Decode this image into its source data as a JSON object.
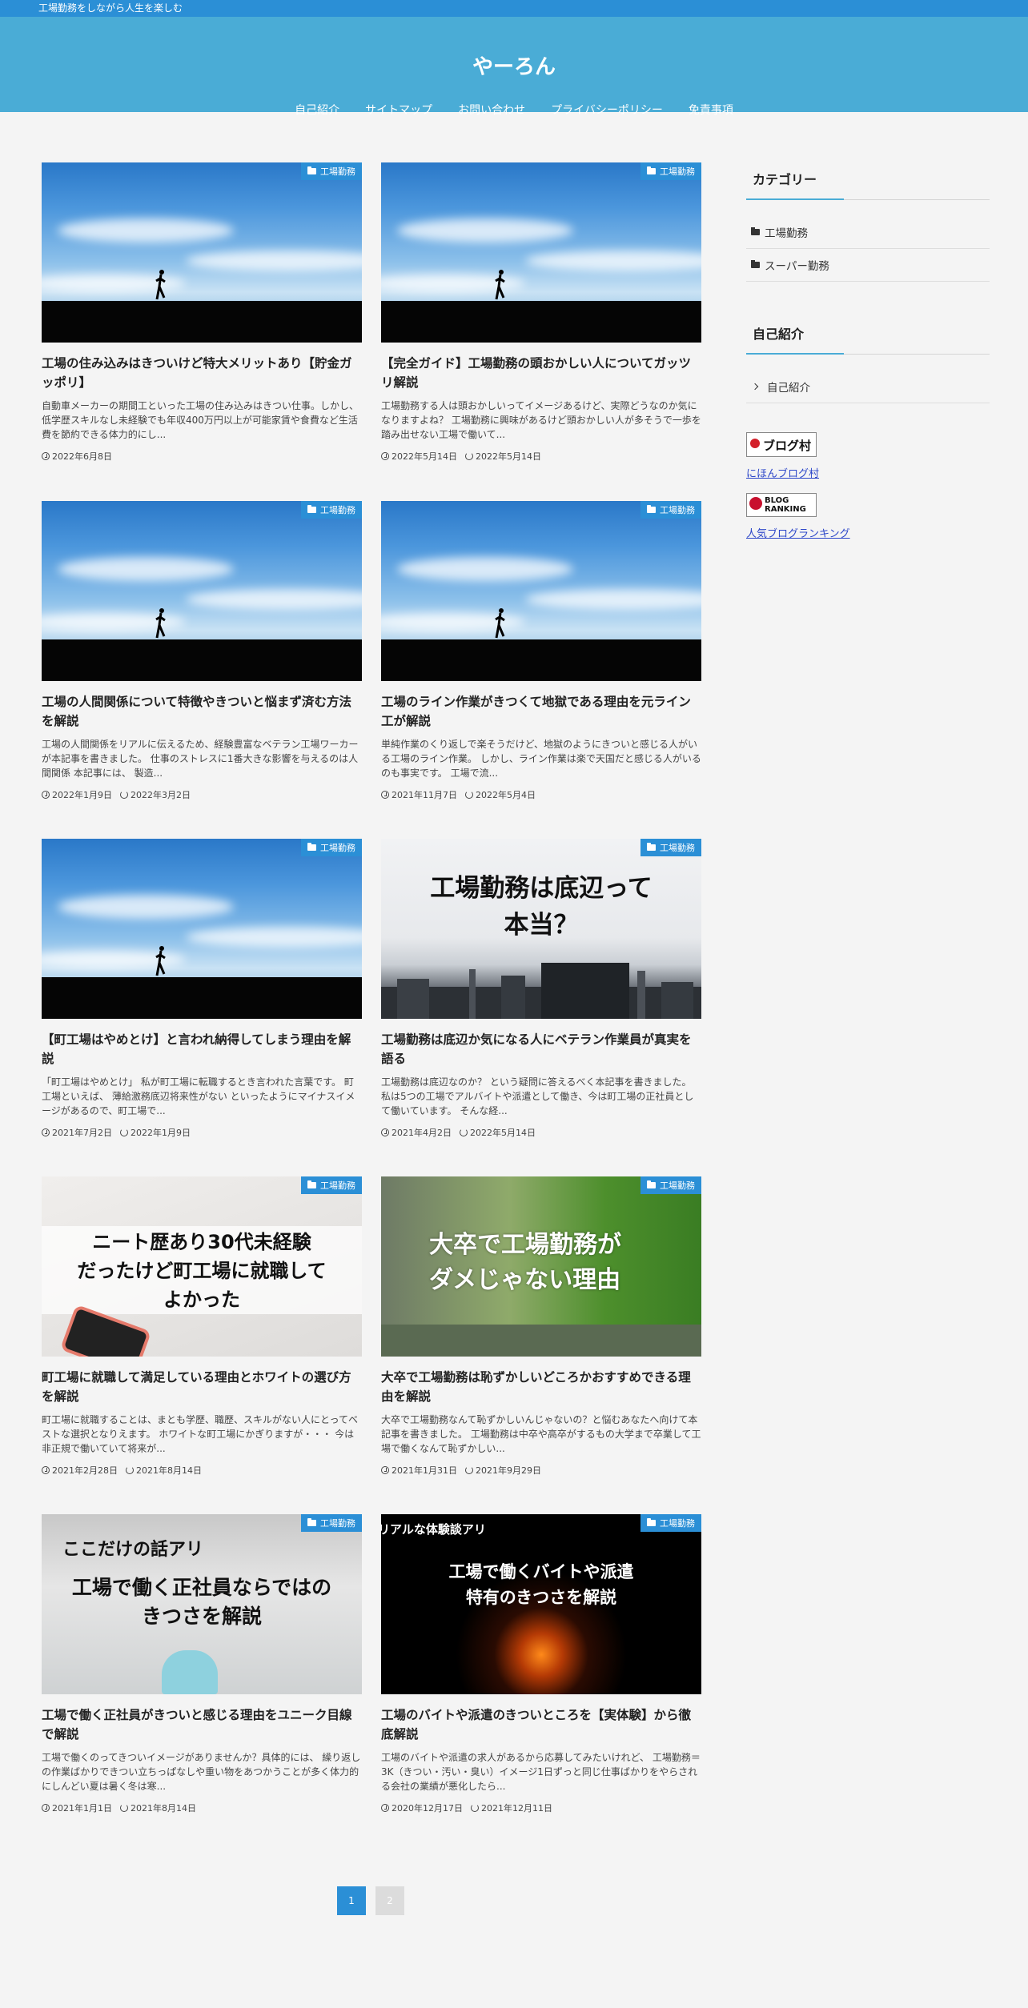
{
  "topbar": {
    "tagline": "工場勤務をしながら人生を楽しむ"
  },
  "site": {
    "title": "やーろん"
  },
  "nav": [
    "自己紹介",
    "サイトマップ",
    "お問い合わせ",
    "プライバシーポリシー",
    "免責事項"
  ],
  "category_label": "工場勤務",
  "posts": [
    {
      "title_l1": "工場の住み込みはきついけど特大メリットあり【貯金ガ",
      "title_l2": "ッポリ】",
      "excerpt": "自動車メーカーの期間工といった工場の住み込みはきつい仕事。しかし、 低学歴スキルなし未経験でも年収400万円以上が可能家賃や食費など生活費を節約できる体力的にし...",
      "date": "2022年6月8日",
      "updated": ""
    },
    {
      "title_l1": "【完全ガイド】工場勤務の頭おかしい人についてガッツ",
      "title_l2": "リ解説",
      "excerpt": "工場勤務する人は頭おかしいってイメージあるけど、実際どうなのか気になりますよね？ 工場勤務に興味があるけど頭おかしい人が多そうで一歩を踏み出せない工場で働いて...",
      "date": "2022年5月14日",
      "updated": "2022年5月14日"
    },
    {
      "title_l1": "工場の人間関係について特徴やきついと悩まず済む方法",
      "title_l2": "を解説",
      "excerpt": "工場の人間関係をリアルに伝えるため、経験豊富なベテラン工場ワーカーが本記事を書きました。 仕事のストレスに1番大きな影響を与えるのは人間関係 本記事には、 製造...",
      "date": "2022年1月9日",
      "updated": "2022年3月2日"
    },
    {
      "title_l1": "工場のライン作業がきつくて地獄である理由を元ライン",
      "title_l2": "工が解説",
      "excerpt": "単純作業のくり返しで楽そうだけど、地獄のようにきついと感じる人がいる工場のライン作業。 しかし、ライン作業は楽で天国だと感じる人がいるのも事実です。 工場で流...",
      "date": "2021年11月7日",
      "updated": "2022年5月4日"
    },
    {
      "title_l1": "【町工場はやめとけ】と言われ納得してしまう理由を解",
      "title_l2": "説",
      "excerpt": "「町工場はやめとけ」 私が町工場に転職するとき言われた言葉です。 町工場といえば、 薄給激務底辺将来性がない といったようにマイナスイメージがあるので、町工場で...",
      "date": "2021年7月2日",
      "updated": "2022年1月9日"
    },
    {
      "title_l1": "工場勤務は底辺か気になる人にベテラン作業員が真実を",
      "title_l2": "語る",
      "excerpt": "工場勤務は底辺なのか？ という疑問に答えるべく本記事を書きました。 私は5つの工場でアルバイトや派遣として働き、今は町工場の正社員として働いています。 そんな経...",
      "date": "2021年4月2日",
      "updated": "2022年5月14日",
      "thumb_text": [
        "工場勤務は底辺って",
        "本当？"
      ]
    },
    {
      "title_l1": "町工場に就職して満足している理由とホワイトの選び方",
      "title_l2": "を解説",
      "excerpt": "町工場に就職することは、まとも学歴、職歴、スキルがない人にとってベストな選択となりえます。 ホワイトな町工場にかぎりますが・・・ 今は非正規で働いていて将来が...",
      "date": "2021年2月28日",
      "updated": "2021年8月14日",
      "thumb_text": [
        "ニート歴あり30代未経験",
        "だったけど町工場に就職して",
        "よかった"
      ]
    },
    {
      "title_l1": "大卒で工場勤務は恥ずかしいどころかおすすめできる理",
      "title_l2": "由を解説",
      "excerpt": "大卒で工場勤務なんて恥ずかしいんじゃないの？と悩むあなたへ向けて本記事を書きました。 工場勤務は中卒や高卒がするもの大学まで卒業して工場で働くなんて恥ずかしい...",
      "date": "2021年1月31日",
      "updated": "2021年9月29日",
      "thumb_text": [
        "大卒で工場勤務が",
        "ダメじゃない理由"
      ]
    },
    {
      "title_l1": "工場で働く正社員がきついと感じる理由をユニーク目線",
      "title_l2": "で解説",
      "excerpt": "工場で働くのってきついイメージがありませんか？具体的には、 繰り返しの作業ばかりできつい立ちっぱなしや重い物をあつかうことが多く体力的にしんどい夏は暑く冬は寒...",
      "date": "2021年1月1日",
      "updated": "2021年8月14日",
      "thumb_text": [
        "ここだけの話アリ",
        "工場で働く正社員ならではの",
        "きつさを解説"
      ]
    },
    {
      "title_l1": "工場のバイトや派遣のきついところを【実体験】から徹",
      "title_l2": "底解説",
      "excerpt": "工場のバイトや派遣の求人があるから応募してみたいけれど、 工場勤務＝3K（きつい・汚い・臭い）イメージ1日ずっと同じ仕事ばかりをやらされる会社の業績が悪化したら...",
      "date": "2020年12月17日",
      "updated": "2021年12月11日",
      "thumb_text": [
        "リアルな体験談アリ",
        "工場で働くバイトや派遣",
        "特有のきつさを解説"
      ]
    }
  ],
  "sidebar": {
    "categories_title": "カテゴリー",
    "categories": [
      "工場勤務",
      "スーパー勤務"
    ],
    "about_title": "自己紹介",
    "about_items": [
      "自己紹介"
    ],
    "banner1_text": "ブログ村",
    "banner1_link": "にほんブログ村",
    "banner2_text": "BLOG RANKING",
    "banner2_link": "人気ブログランキング"
  },
  "pagination": [
    "1",
    "2"
  ]
}
